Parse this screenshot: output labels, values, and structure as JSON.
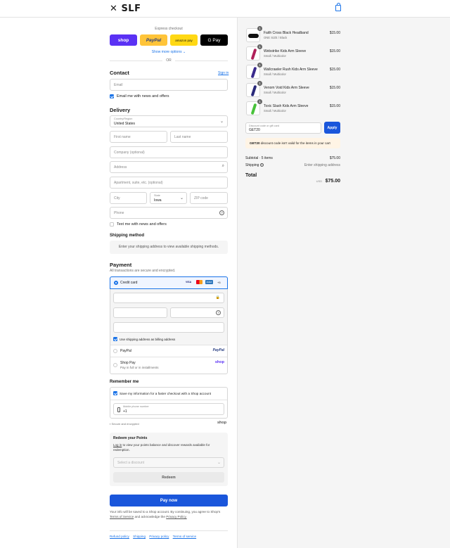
{
  "header": {
    "brand": "SLF"
  },
  "express": {
    "title": "Express checkout",
    "shop_label": "shop",
    "paypal_label": "PayPal",
    "amazon_label": "amazon pay",
    "gpay_label": "G Pay",
    "more_options": "Show more options",
    "or": "OR"
  },
  "contact": {
    "title": "Contact",
    "sign_in": "Sign in",
    "email_placeholder": "Email",
    "email_news": "Email me with news and offers"
  },
  "delivery": {
    "title": "Delivery",
    "country_label": "Country/Region",
    "country_value": "United States",
    "first_name": "First name",
    "last_name": "Last name",
    "company": "Company (optional)",
    "address": "Address",
    "apartment": "Apartment, suite, etc. (optional)",
    "city": "City",
    "state_label": "State",
    "state_value": "Iowa",
    "zip": "ZIP code",
    "phone": "Phone",
    "text_news": "Text me with news and offers"
  },
  "shipping": {
    "title": "Shipping method",
    "message": "Enter your shipping address to view available shipping methods."
  },
  "payment": {
    "title": "Payment",
    "subtitle": "All transactions are secure and encrypted.",
    "credit_card": "Credit card",
    "card_brands": [
      "VISA",
      "MC",
      "AMEX"
    ],
    "more_brands": "+5",
    "billing_same": "Use shipping address as billing address",
    "paypal": "PayPal",
    "paypal_logo": "PayPal",
    "shop_pay": "Shop Pay",
    "shop_pay_sub": "Pay in full or in installments",
    "shop_logo": "shop"
  },
  "remember": {
    "title": "Remember me",
    "save_info": "Save my information for a faster checkout with a Shop account",
    "mobile_label": "Mobile phone number",
    "mobile_value": "+1",
    "secure": "Secure and encrypted",
    "shop_logo": "shop"
  },
  "points": {
    "title": "Redeem your Points",
    "text_link": "Log in",
    "text_rest": "to view your points balance and discover rewards available for redemption.",
    "select_placeholder": "Select a discount",
    "redeem": "Redeem"
  },
  "pay_now": "Pay now",
  "legal": {
    "text1": "Your info will be saved to a Shop account. By continuing, you agree to Shop's",
    "tos": "Terms of Service",
    "and": "and acknowledge the",
    "privacy": "Privacy Policy."
  },
  "footer_links": [
    "Refund policy",
    "Shipping",
    "Privacy policy",
    "Terms of service"
  ],
  "cart": {
    "items": [
      {
        "name": "Faith Cross Black Headband",
        "variant": "ONE SIZE / Black",
        "price": "$15.00",
        "qty": "1",
        "color": "#111111"
      },
      {
        "name": "Webstrike Kids Arm Sleeve",
        "variant": "Small / Multicolor",
        "price": "$15.00",
        "qty": "1",
        "color": "#b0205a"
      },
      {
        "name": "Wallcrawler Rush Kids Arm Sleeve",
        "variant": "Small / Multicolor",
        "price": "$15.00",
        "qty": "1",
        "color": "#3a2a8c"
      },
      {
        "name": "Venom Void Kids Arm Sleeve",
        "variant": "Small / Multicolor",
        "price": "$15.00",
        "qty": "1",
        "color": "#2a2a7a"
      },
      {
        "name": "Toxic Slash Kids Arm Sleeve",
        "variant": "Small / Multicolor",
        "price": "$15.00",
        "qty": "1",
        "color": "#48c23a"
      }
    ],
    "discount_label": "Discount code or gift card",
    "discount_value": "GET20",
    "apply": "Apply",
    "error_code": "GET20",
    "error_text": "discount code isn't valid for the items in your cart",
    "subtotal_label": "Subtotal · 5 items",
    "subtotal_value": "$75.00",
    "shipping_label": "Shipping",
    "shipping_value": "Enter shipping address",
    "total_label": "Total",
    "currency": "USD",
    "total_value": "$75.00"
  },
  "colors": {
    "accent": "#1a73e8",
    "shop": "#5a31f4",
    "paypal": "#ffc439",
    "error_bg": "#fff4e5"
  }
}
